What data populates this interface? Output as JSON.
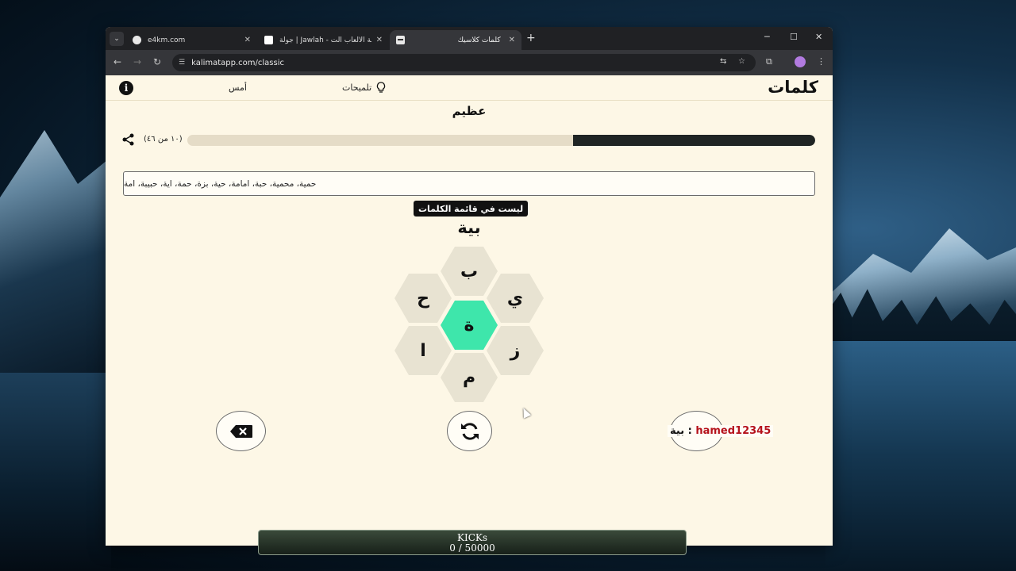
{
  "browser": {
    "tabs": [
      {
        "title": "e4km.com",
        "active": false
      },
      {
        "title": "جولة | Jawlah - منصة الألعاب الت",
        "active": false
      },
      {
        "title": "كلمات كلاسيك",
        "active": true
      }
    ],
    "url": "kalimatapp.com/classic"
  },
  "header": {
    "logo": "كلمات",
    "hints_label": "تلميحات",
    "yesterday_label": "أمس",
    "info_glyph": "i"
  },
  "game": {
    "rank": "عظيم",
    "count_text": "(١٠ من ٤٦)",
    "progress_fraction": 0.385,
    "found_words": "حمية، محمية، حبة، امامة، حية، بزة، حمة، اية، حبيبة، امة",
    "toast": "ليست في قائمة الكلمات",
    "current_word": "بية",
    "center_letter": "ة",
    "outer_letters": {
      "top": "ب",
      "top_left": "ح",
      "top_right": "ي",
      "bottom_left": "ا",
      "bottom_right": "ز",
      "bottom": "م"
    }
  },
  "chat": {
    "word": "بية :",
    "user": "hamed12345"
  },
  "overlay": {
    "kicks_label": "KICKs",
    "kicks_value": "0 / 50000"
  },
  "colors": {
    "center_hex": "#3ee6ab",
    "outer_hex": "#e8e3d2",
    "page_bg": "#fdf7e6",
    "progress_fill": "#1f2424"
  }
}
